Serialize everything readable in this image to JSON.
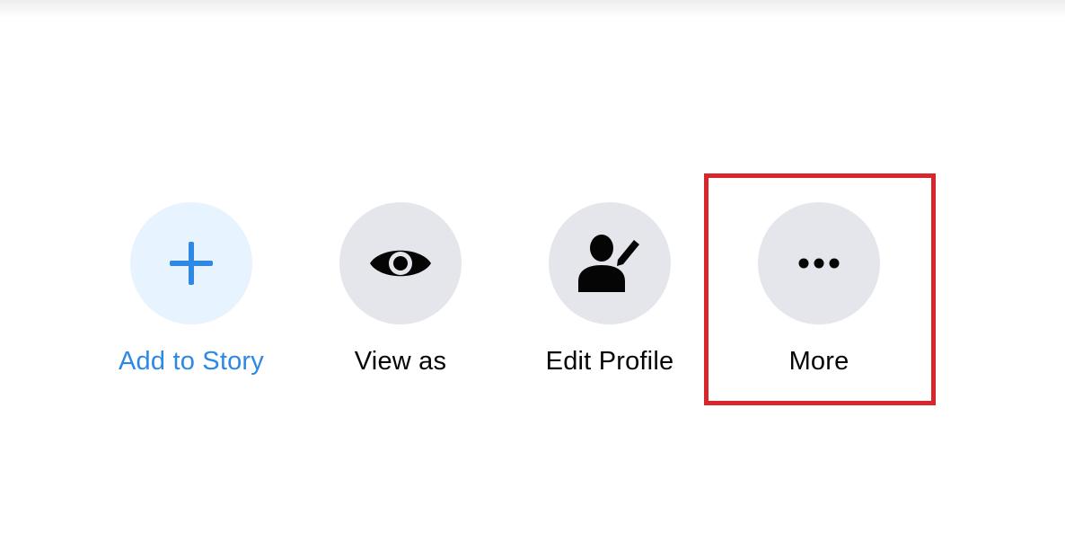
{
  "actions": [
    {
      "label": "Add to Story",
      "icon": "plus-icon",
      "style": "primary"
    },
    {
      "label": "View as",
      "icon": "eye-icon",
      "style": "default"
    },
    {
      "label": "Edit Profile",
      "icon": "edit-profile-icon",
      "style": "default"
    },
    {
      "label": "More",
      "icon": "more-dots-icon",
      "style": "default",
      "highlighted": true
    }
  ],
  "colors": {
    "primary_text": "#2d88e6",
    "primary_circle": "#e7f3ff",
    "default_circle": "#e4e6eb",
    "highlight_border": "#d8262c"
  }
}
